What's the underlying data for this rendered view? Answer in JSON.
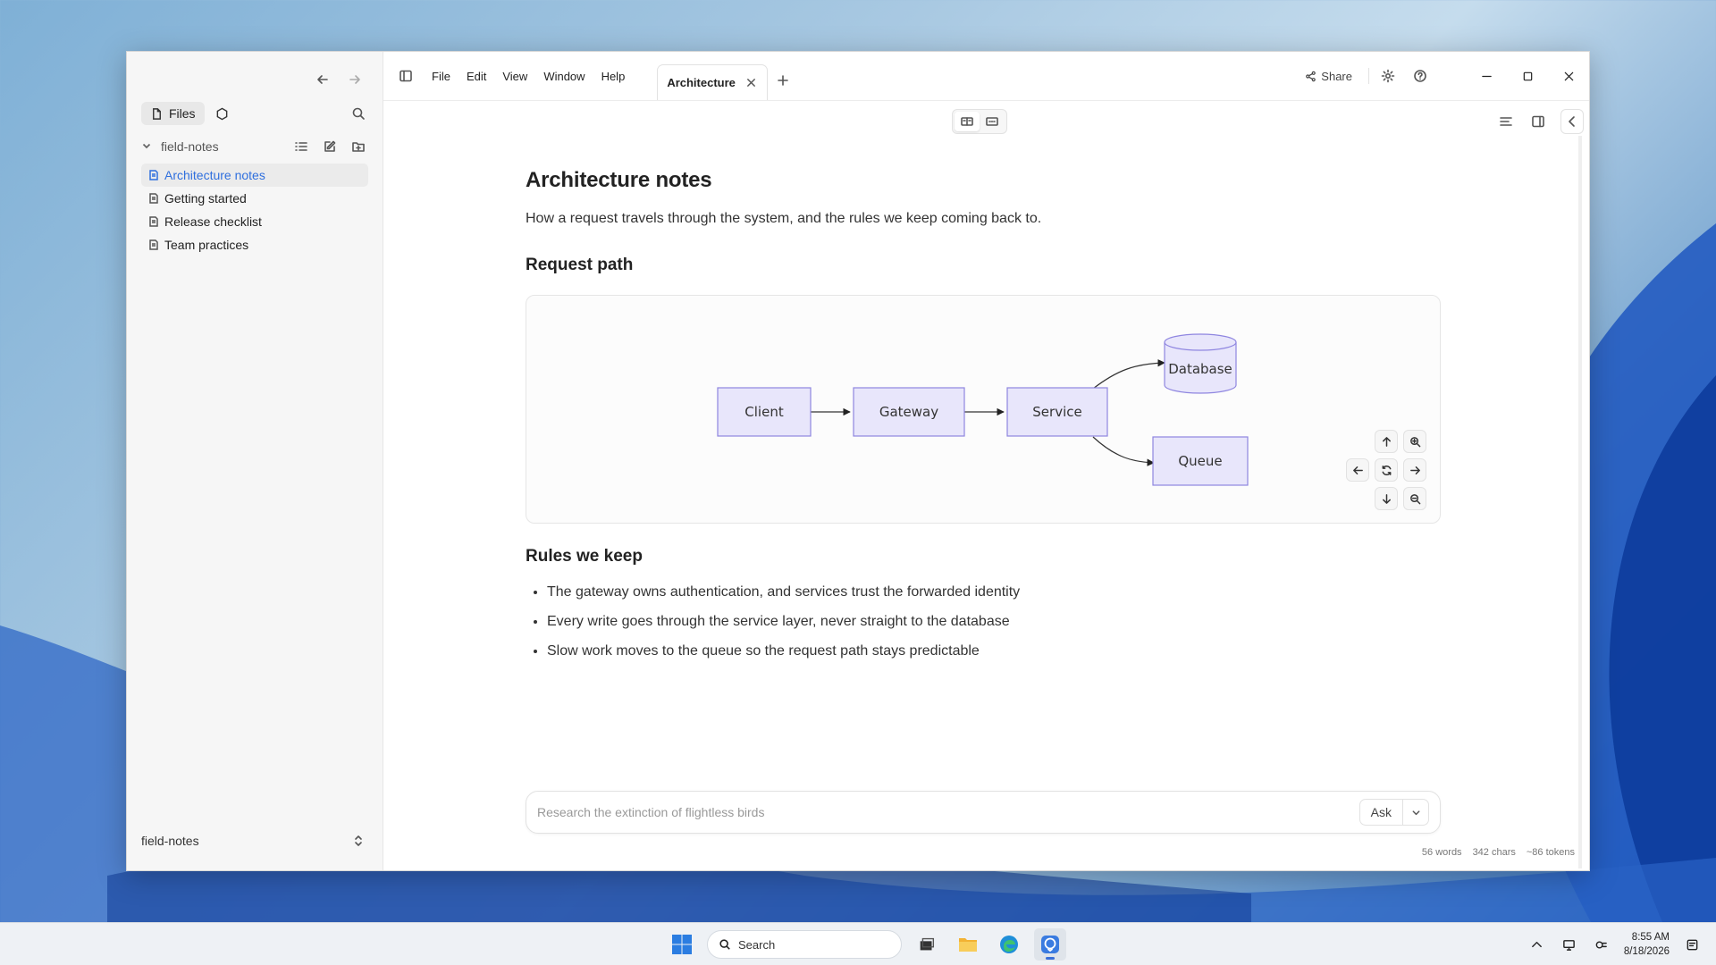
{
  "sidebar": {
    "tabs": {
      "files_label": "Files"
    },
    "vault_name": "field-notes",
    "files": [
      {
        "label": "Architecture notes",
        "active": true
      },
      {
        "label": "Getting started",
        "active": false
      },
      {
        "label": "Release checklist",
        "active": false
      },
      {
        "label": "Team practices",
        "active": false
      }
    ],
    "footer_vault": "field-notes"
  },
  "topbar": {
    "menu": [
      "File",
      "Edit",
      "View",
      "Window",
      "Help"
    ],
    "active_tab": "Architecture",
    "share_label": "Share"
  },
  "document": {
    "title": "Architecture notes",
    "intro": "How a request travels through the system, and the rules we keep coming back to.",
    "section1": "Request path",
    "diagram": {
      "nodes": [
        "Client",
        "Gateway",
        "Service",
        "Database",
        "Queue"
      ],
      "fill": "#e8e6fb",
      "stroke": "#8f86e0"
    },
    "section2": "Rules we keep",
    "rules": [
      "The gateway owns authentication, and services trust the forwarded identity",
      "Every write goes through the service layer, never straight to the database",
      "Slow work moves to the queue so the request path stays predictable"
    ]
  },
  "ask": {
    "placeholder": "Research the extinction of flightless birds",
    "button": "Ask"
  },
  "stats": {
    "words": "56 words",
    "chars": "342 chars",
    "tokens": "~86 tokens"
  },
  "taskbar": {
    "search_label": "Search",
    "time": "8:55 AM",
    "date": "8/18/2026"
  },
  "colors": {
    "accent": "#2f6fde",
    "taskbar_indicator": "#3a6fd8"
  }
}
